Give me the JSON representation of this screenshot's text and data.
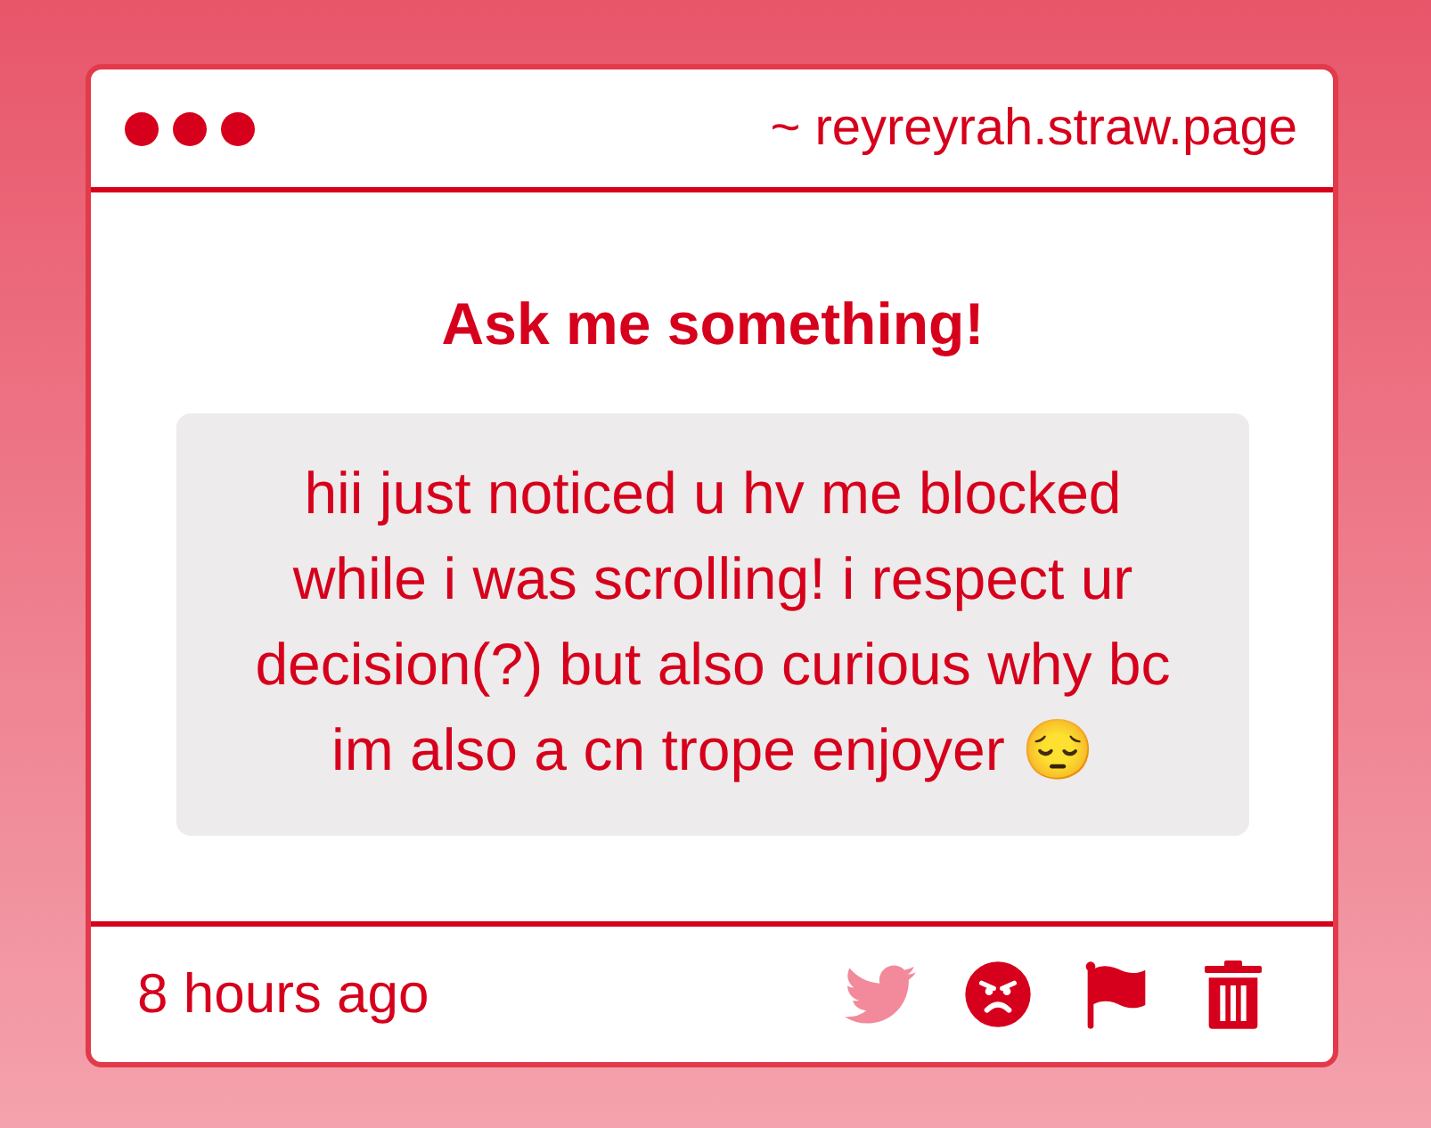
{
  "window": {
    "address": "~ reyreyrah.straw.page"
  },
  "prompt": {
    "title": "Ask me something!"
  },
  "question": {
    "text": "hii just noticed u hv me blocked while i was scrolling! i respect ur decision(?) but also curious why bc im also a cn trope enjoyer 😔"
  },
  "footer": {
    "time": "8 hours ago",
    "actions": [
      {
        "kind": "share",
        "disabled": true
      },
      {
        "kind": "react",
        "disabled": false
      },
      {
        "kind": "report",
        "disabled": false
      },
      {
        "kind": "delete",
        "disabled": false
      }
    ]
  }
}
